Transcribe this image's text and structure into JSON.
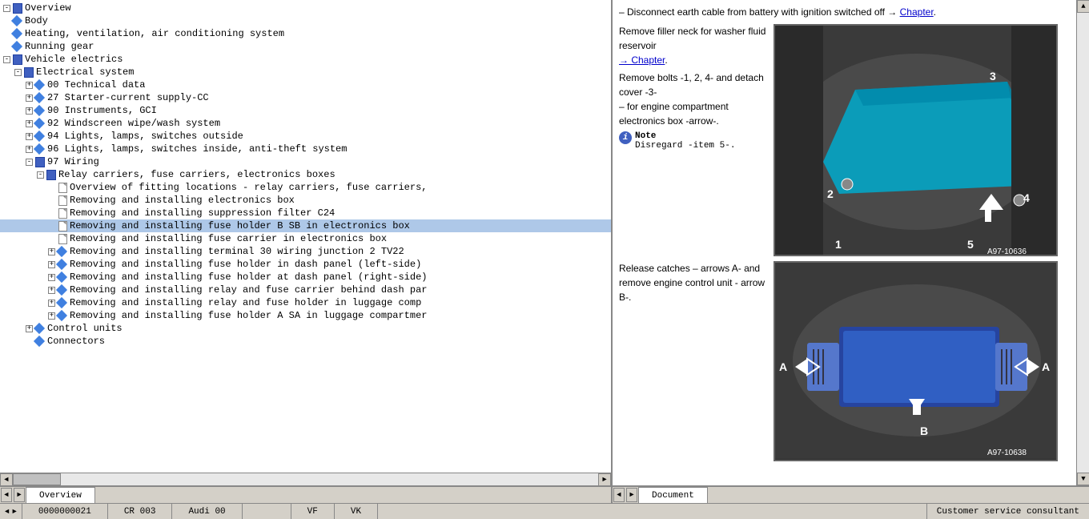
{
  "header": {
    "chapter_link": "Chapter"
  },
  "left_panel": {
    "tree_items": [
      {
        "id": "overview",
        "label": "Overview",
        "level": 0,
        "type": "book",
        "expanded": true
      },
      {
        "id": "body",
        "label": "Body",
        "level": 0,
        "type": "diamond"
      },
      {
        "id": "heating",
        "label": "Heating, ventilation, air conditioning system",
        "level": 0,
        "type": "diamond"
      },
      {
        "id": "running",
        "label": "Running gear",
        "level": 0,
        "type": "diamond"
      },
      {
        "id": "vehicle-electrics",
        "label": "Vehicle electrics",
        "level": 0,
        "type": "book",
        "expanded": true
      },
      {
        "id": "electrical-system",
        "label": "Electrical system",
        "level": 1,
        "type": "book",
        "expanded": true
      },
      {
        "id": "tech-data",
        "label": "00 Technical data",
        "level": 2,
        "type": "diamond",
        "has_expand": true
      },
      {
        "id": "starter",
        "label": "27 Starter-current supply-CC",
        "level": 2,
        "type": "diamond",
        "has_expand": true
      },
      {
        "id": "instruments",
        "label": "90 Instruments, GCI",
        "level": 2,
        "type": "diamond",
        "has_expand": true
      },
      {
        "id": "windscreen",
        "label": "92 Windscreen wipe/wash system",
        "level": 2,
        "type": "diamond",
        "has_expand": true
      },
      {
        "id": "lights-outside",
        "label": "94 Lights, lamps, switches outside",
        "level": 2,
        "type": "diamond",
        "has_expand": true
      },
      {
        "id": "lights-inside",
        "label": "96 Lights, lamps, switches inside, anti-theft system",
        "level": 2,
        "type": "diamond",
        "has_expand": true
      },
      {
        "id": "wiring",
        "label": "97 Wiring",
        "level": 2,
        "type": "book",
        "has_expand": true,
        "expanded": true
      },
      {
        "id": "relay-carriers",
        "label": "Relay carriers, fuse carriers, electronics boxes",
        "level": 3,
        "type": "book",
        "has_expand": true,
        "expanded": true
      },
      {
        "id": "overview-fitting",
        "label": "Overview of fitting locations - relay carriers, fuse carriers,",
        "level": 4,
        "type": "doc"
      },
      {
        "id": "removing-electronics",
        "label": "Removing and installing electronics box",
        "level": 4,
        "type": "doc"
      },
      {
        "id": "removing-suppression",
        "label": "Removing and installing suppression filter C24",
        "level": 4,
        "type": "doc"
      },
      {
        "id": "removing-fuse-sb",
        "label": "Removing and installing fuse holder B SB in electronics box",
        "level": 4,
        "type": "doc",
        "selected": true
      },
      {
        "id": "removing-fuse-carrier",
        "label": "Removing and installing fuse carrier in electronics box",
        "level": 4,
        "type": "doc"
      },
      {
        "id": "removing-terminal30",
        "label": "Removing and installing terminal 30 wiring junction 2 TV22",
        "level": 4,
        "type": "diamond",
        "has_expand": true
      },
      {
        "id": "removing-fuse-left",
        "label": "Removing and installing fuse holder in dash panel (left-side)",
        "level": 4,
        "type": "diamond",
        "has_expand": true
      },
      {
        "id": "removing-fuse-right",
        "label": "Removing and installing fuse holder at dash panel (right-side)",
        "level": 4,
        "type": "diamond",
        "has_expand": true
      },
      {
        "id": "removing-relay-dash",
        "label": "Removing and installing relay and fuse carrier behind dash par",
        "level": 4,
        "type": "diamond",
        "has_expand": true
      },
      {
        "id": "removing-relay-luggage",
        "label": "Removing and installing relay and fuse holder in luggage comp",
        "level": 4,
        "type": "diamond",
        "has_expand": true
      },
      {
        "id": "removing-fuse-sa",
        "label": "Removing and installing fuse holder A SA in luggage compartmer",
        "level": 4,
        "type": "diamond",
        "has_expand": true
      },
      {
        "id": "control-units",
        "label": "Control units",
        "level": 2,
        "type": "diamond",
        "has_expand": true
      },
      {
        "id": "connectors",
        "label": "Connectors",
        "level": 2,
        "type": "diamond"
      }
    ]
  },
  "right_panel": {
    "intro_text": "– Disconnect earth cable from battery with ignition switched off →",
    "chapter_link": "Chapter",
    "top_section": {
      "instruction": "Remove filler neck for washer fluid reservoir → Chapter.",
      "instruction2": "Remove bolts -1, 2, 4- and detach cover -3- for engine compartment electronics box -arrow-.",
      "note_label": "Note",
      "note_text": "Disregard -item 5-.",
      "image_labels": [
        "3",
        "2",
        "4",
        "1",
        "5"
      ],
      "image_ref": "A97-10636"
    },
    "bottom_section": {
      "instruction": "Release catches – arrows A- and remove engine control unit - arrow B-.",
      "image_labels": [
        "A",
        "A",
        "B"
      ],
      "image_ref": "A97-10638"
    }
  },
  "tabs": {
    "left_tabs": [
      "Overview"
    ],
    "right_tabs": [
      "Document"
    ]
  },
  "status_bar": {
    "items": [
      "",
      "CR 003",
      "Audi 00",
      "",
      "VF",
      "VK",
      ""
    ],
    "right_item": "Customer service consultant"
  }
}
